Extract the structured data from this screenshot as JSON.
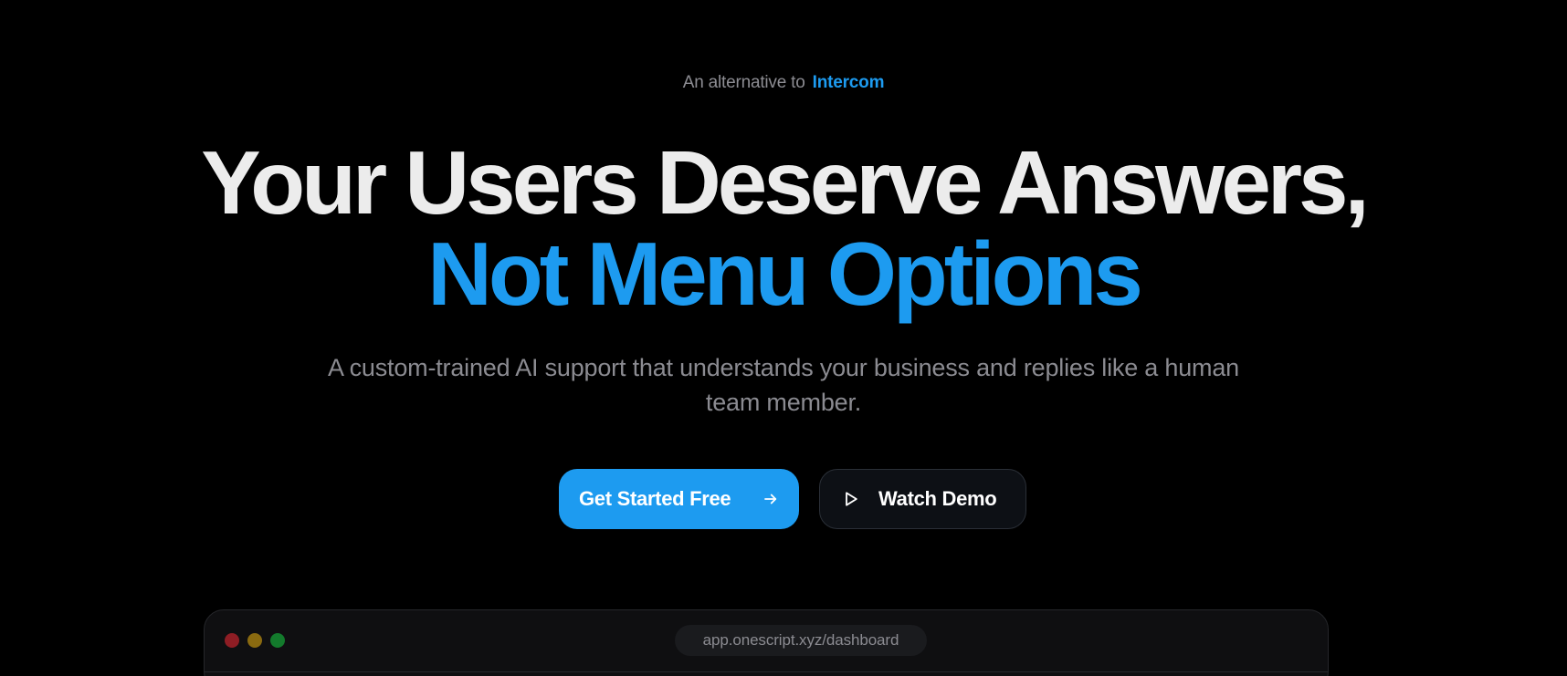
{
  "hero": {
    "eyebrow_prefix": "An alternative to",
    "eyebrow_brand": "Intercom",
    "headline_line1": "Your Users Deserve Answers,",
    "headline_line2": "Not Menu Options",
    "subhead": "A custom-trained AI support that understands your business and replies like a human team member.",
    "primary_cta": "Get Started Free",
    "secondary_cta": "Watch Demo"
  },
  "browser_preview": {
    "url": "app.onescript.xyz/dashboard"
  },
  "icons": {
    "primary_cta_icon": "arrow-right-icon",
    "secondary_cta_icon": "play-icon"
  },
  "colors": {
    "background": "#000000",
    "accent": "#1d9bf0",
    "headline": "#ececec",
    "muted_text": "#8b8b91"
  }
}
